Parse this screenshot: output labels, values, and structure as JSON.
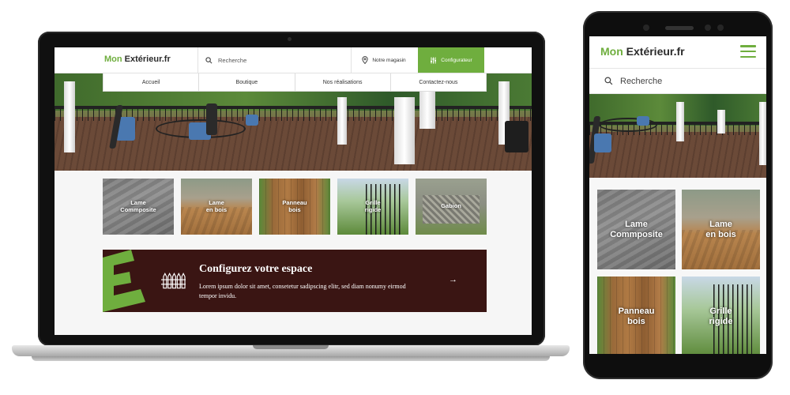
{
  "brand": {
    "logo_mon": "Mon",
    "logo_rest": " Extérieur.fr",
    "green": "#6fae3e",
    "banner_color": "#3a1513"
  },
  "desktop": {
    "search_placeholder": "Recherche",
    "store_label": "Notre magasin",
    "config_label": "Configurateur",
    "nav": [
      {
        "label": "Accueil"
      },
      {
        "label": "Boutique"
      },
      {
        "label": "Nos réalisations"
      },
      {
        "label": "Contactez-nous"
      }
    ],
    "categories": [
      {
        "label": "Lame\nCommposite"
      },
      {
        "label": "Lame\nen bois"
      },
      {
        "label": "Panneau\nbois"
      },
      {
        "label": "Grille\nrigide"
      },
      {
        "label": "Gabion"
      }
    ],
    "banner": {
      "title": "Configurez votre espace",
      "text": "Lorem ipsum dolor sit amet, consetetur sadipscing elitr, sed diam nonumy eirmod tempor invidu.",
      "arrow": "→"
    }
  },
  "mobile": {
    "search_placeholder": "Recherche",
    "categories": [
      {
        "label": "Lame\nCommposite"
      },
      {
        "label": "Lame\nen bois"
      },
      {
        "label": "Panneau\nbois"
      },
      {
        "label": "Grille\nrigide"
      }
    ]
  },
  "icons": [
    "search-icon",
    "location-pin-icon",
    "sliders-icon",
    "fence-icon",
    "arrow-right-icon",
    "hamburger-menu-icon"
  ]
}
